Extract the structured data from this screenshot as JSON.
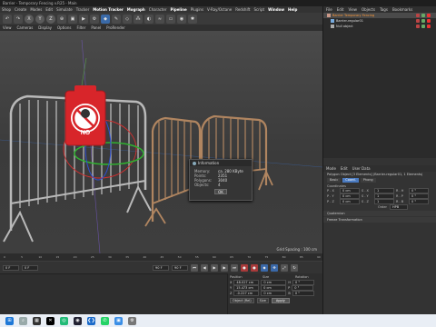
{
  "window_title": "Barrier - Temporary Fencing v.R25 - Main",
  "menu": [
    "Shop",
    "Create",
    "Modes",
    "Edit",
    "Simulate",
    "Tracker",
    "Motion Tracker",
    "Mograph",
    "Character",
    "Pipeline",
    "Plugins",
    "V-Ray/Octane",
    "Redshift",
    "Script",
    "Window",
    "Help"
  ],
  "menu_highlight": [
    "Mograph",
    "Window"
  ],
  "toolbar": {
    "icons": [
      "undo-icon",
      "redo-icon",
      "x-axis-icon",
      "y-axis-icon",
      "z-axis-icon",
      "world-coord-icon",
      "render-region-icon",
      "render-view-icon",
      "render-settings-icon",
      "cube-icon",
      "pen-icon",
      "subdivision-icon",
      "array-icon",
      "boole-icon",
      "deformer-icon",
      "floor-icon",
      "camera-icon",
      "light-icon"
    ],
    "axis_labels": [
      "X",
      "Y",
      "Z"
    ]
  },
  "viewport": {
    "menu": [
      "View",
      "Cameras",
      "Display",
      "Options",
      "Filter",
      "Panel",
      "ProRender"
    ],
    "grid_spacing": "Grid Spacing : 100 cm",
    "sign_text": "NO"
  },
  "info_dialog": {
    "title": "Information",
    "rows": [
      {
        "k": "Memory:",
        "v": "ca. 280 KByte"
      },
      {
        "k": "Points:",
        "v": "2351"
      },
      {
        "k": "Polygons:",
        "v": "3040"
      },
      {
        "k": "Objects:",
        "v": "4"
      }
    ],
    "ok_label": "OK"
  },
  "timeline": {
    "ticks": [
      "0",
      "5",
      "10",
      "15",
      "20",
      "25",
      "30",
      "35",
      "40",
      "45",
      "50",
      "55",
      "60",
      "65",
      "70",
      "75",
      "80",
      "85",
      "90"
    ],
    "start": "0 F",
    "start2": "0 F",
    "end": "90 F",
    "end2": "90 F"
  },
  "coord_panel": {
    "headers": [
      "Position",
      "Size",
      "Rotation"
    ],
    "rows": [
      {
        "a": "X",
        "pos": "48.027 cm",
        "size": "0 cm",
        "rot_label": "H",
        "rot": "0 °"
      },
      {
        "a": "Y",
        "pos": "15.473 cm",
        "size": "0 cm",
        "rot_label": "P",
        "rot": "0 °"
      },
      {
        "a": "Z",
        "pos": "-0.227 cm",
        "size": "0 cm",
        "rot_label": "B",
        "rot": "0 °"
      }
    ],
    "mode_object": "Object (Rel)",
    "mode_size": "Size",
    "apply": "Apply"
  },
  "object_manager": {
    "menu": [
      "File",
      "Edit",
      "View",
      "Objects",
      "Tags",
      "Bookmarks"
    ],
    "objects": [
      {
        "name": "Barrier Temporary Fencing",
        "selected": true
      },
      {
        "name": "Barrier-regular01",
        "selected": false
      },
      {
        "name": "Null object",
        "selected": false
      }
    ]
  },
  "attributes": {
    "menu": [
      "Mode",
      "Edit",
      "User Data"
    ],
    "title": "Polygon Object [3 Elements] (Barrier-regular01, 1 Elements)",
    "tabs": [
      "Basic",
      "Coord.",
      "Phong"
    ],
    "active_tab": "Coord.",
    "section_head": "Coordinates",
    "rows": [
      {
        "p": "P . X",
        "pv": "0 cm",
        "s": "S . X",
        "sv": "1",
        "r": "R . H",
        "rv": "0 °"
      },
      {
        "p": "P . Y",
        "pv": "0 cm",
        "s": "S . Y",
        "sv": "1",
        "r": "R . P",
        "rv": "0 °"
      },
      {
        "p": "P . Z",
        "pv": "0 cm",
        "s": "S . Z",
        "sv": "1",
        "r": "R . B",
        "rv": "0 °"
      }
    ],
    "order_label": "Order",
    "order_value": "HPB",
    "sections": [
      "Quaternion",
      "Freeze Transformation"
    ]
  },
  "colors": {
    "accent": "#4a7ac0",
    "sign_red": "#d8252a",
    "selected_obj": "#ff9a3a"
  },
  "taskbar_icons": [
    "windows-start-icon",
    "search-icon",
    "widgets-icon",
    "x-app-icon",
    "chrome-icon",
    "cinema4d-icon",
    "vscode-icon",
    "whatsapp-icon",
    "photos-icon",
    "settings-icon"
  ]
}
